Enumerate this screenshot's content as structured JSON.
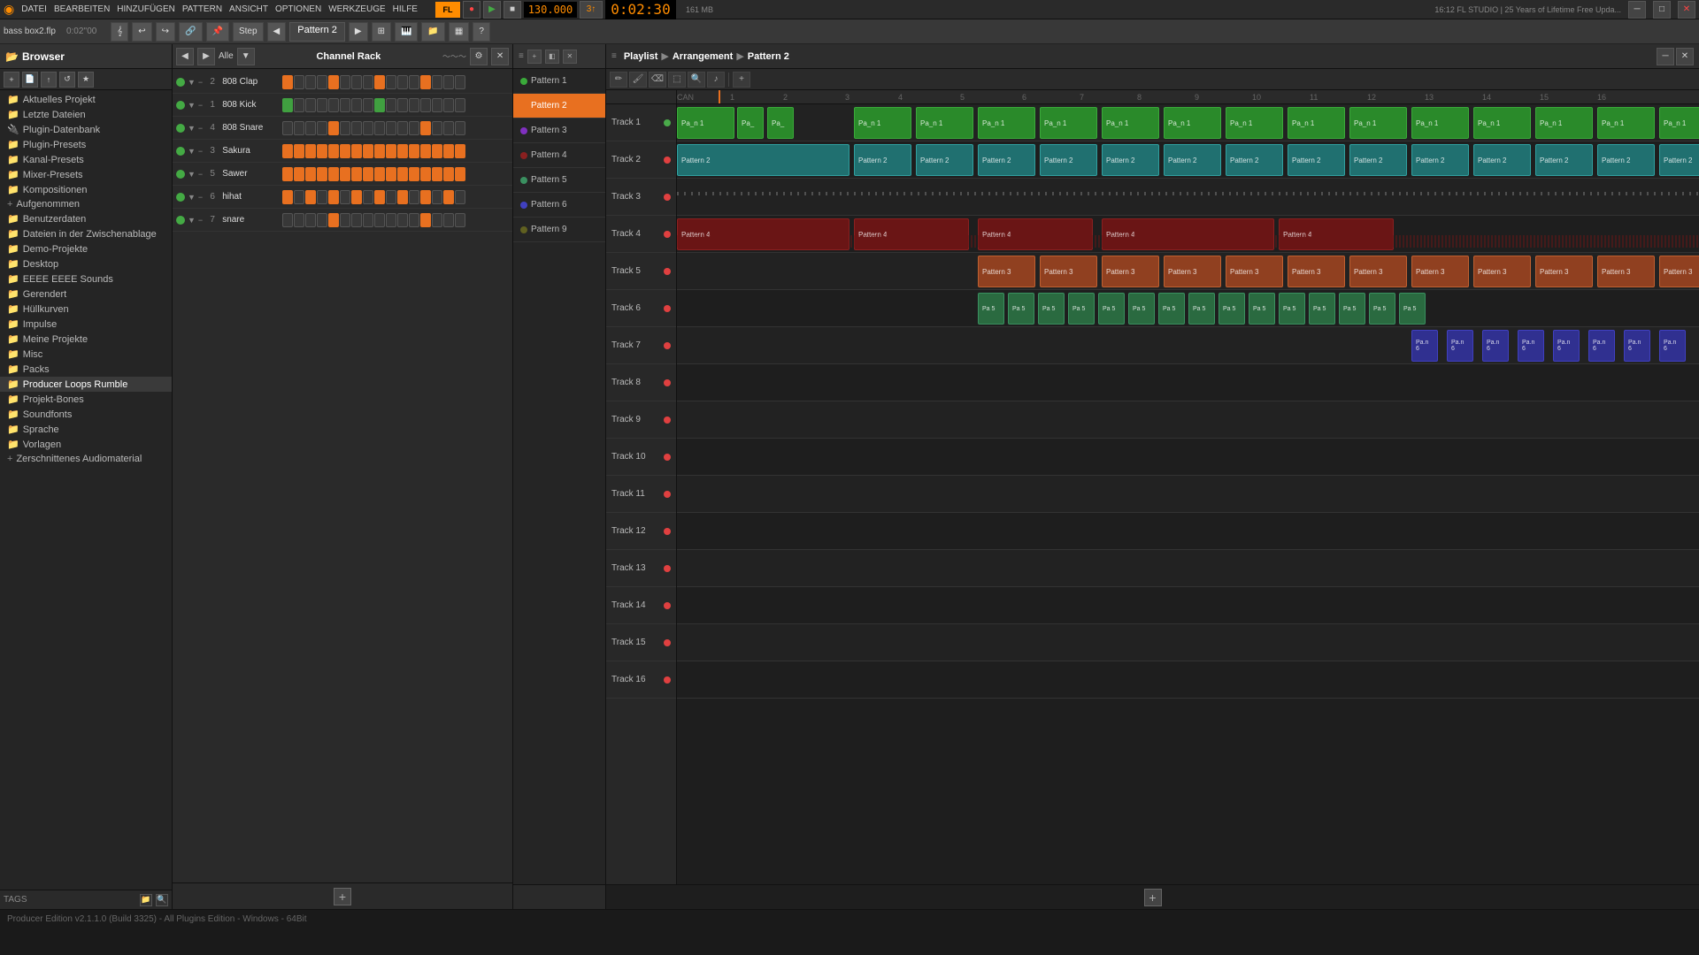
{
  "top_menu": {
    "items": [
      "DATEI",
      "BEARBEITEN",
      "HINZUFÜGEN",
      "PATTERN",
      "ANSICHT",
      "OPTIONEN",
      "WERKZEUGE",
      "HILFE"
    ]
  },
  "transport": {
    "bpm": "130.000",
    "time": "0:02:30",
    "beats": "3",
    "record_label": "●",
    "play_label": "▶",
    "stop_label": "■",
    "cpu_label": "161 MB",
    "fl_version": "16:12  FL STUDIO | 25\nYears of Lifetime Free Upda..."
  },
  "toolbar2": {
    "step_label": "Step",
    "pattern_label": "Pattern 2",
    "file_label": "bass box2.flp",
    "time_label": "0:02''00"
  },
  "browser": {
    "title": "Browser",
    "items": [
      {
        "label": "Aktuelles Projekt",
        "icon": "folder",
        "type": "folder"
      },
      {
        "label": "Letzte Dateien",
        "icon": "folder",
        "type": "folder"
      },
      {
        "label": "Plugin-Datenbank",
        "icon": "folder",
        "type": "folder"
      },
      {
        "label": "Plugin-Presets",
        "icon": "folder",
        "type": "folder"
      },
      {
        "label": "Kanal-Presets",
        "icon": "folder",
        "type": "folder"
      },
      {
        "label": "Mixer-Presets",
        "icon": "folder",
        "type": "folder"
      },
      {
        "label": "Kompositionen",
        "icon": "folder",
        "type": "folder"
      },
      {
        "label": "Aufgenommen",
        "icon": "add",
        "type": "add-folder"
      },
      {
        "label": "Benutzerdaten",
        "icon": "folder",
        "type": "folder"
      },
      {
        "label": "Dateien in der Zwischenablage",
        "icon": "folder",
        "type": "folder"
      },
      {
        "label": "Demo-Projekte",
        "icon": "folder",
        "type": "folder"
      },
      {
        "label": "Desktop",
        "icon": "folder",
        "type": "folder"
      },
      {
        "label": "EEEE EEEE Sounds",
        "icon": "folder",
        "type": "folder"
      },
      {
        "label": "Gerendert",
        "icon": "folder",
        "type": "folder"
      },
      {
        "label": "Hüllkurven",
        "icon": "folder",
        "type": "folder"
      },
      {
        "label": "Impulse",
        "icon": "folder",
        "type": "folder"
      },
      {
        "label": "Meine Projekte",
        "icon": "folder",
        "type": "folder"
      },
      {
        "label": "Misc",
        "icon": "folder",
        "type": "folder"
      },
      {
        "label": "Packs",
        "icon": "folder",
        "type": "folder"
      },
      {
        "label": "Producer Loops Rumble",
        "icon": "folder",
        "type": "folder"
      },
      {
        "label": "Projekt-Bones",
        "icon": "folder",
        "type": "folder"
      },
      {
        "label": "Soundfonts",
        "icon": "folder",
        "type": "folder"
      },
      {
        "label": "Sprache",
        "icon": "folder",
        "type": "folder"
      },
      {
        "label": "Vorlagen",
        "icon": "folder",
        "type": "folder"
      },
      {
        "label": "Zerschnittenes Audiomaterial",
        "icon": "add",
        "type": "add-folder"
      }
    ],
    "tags_label": "TAGS"
  },
  "channel_rack": {
    "title": "Channel Rack",
    "filter_label": "Alle",
    "channels": [
      {
        "num": "2",
        "name": "808 Clap",
        "color": "#e87020"
      },
      {
        "num": "1",
        "name": "808 Kick",
        "color": "#4a8a4a"
      },
      {
        "num": "4",
        "name": "808 Snare",
        "color": "#e87020"
      },
      {
        "num": "3",
        "name": "Sakura",
        "color": "#e87020"
      },
      {
        "num": "5",
        "name": "Sawer",
        "color": "#e87020"
      },
      {
        "num": "6",
        "name": "hihat",
        "color": "#e87020"
      },
      {
        "num": "7",
        "name": "snare",
        "color": "#e87020"
      }
    ]
  },
  "patterns": {
    "title": "Patterns",
    "items": [
      {
        "label": "Pattern 1",
        "color": "#3aaa3a"
      },
      {
        "label": "Pattern 2",
        "color": "#e87020",
        "selected": true
      },
      {
        "label": "Pattern 3",
        "color": "#8030c0"
      },
      {
        "label": "Pattern 4",
        "color": "#8a2020"
      },
      {
        "label": "Pattern 5",
        "color": "#3a9060"
      },
      {
        "label": "Pattern 6",
        "color": "#4040c0"
      },
      {
        "label": "Pattern 9",
        "color": "#606020"
      }
    ]
  },
  "playlist": {
    "title": "Playlist",
    "subtitle": "Arrangement",
    "pattern": "Pattern 2",
    "tracks": [
      {
        "label": "Track 1",
        "color": "#2a8a2a",
        "dot_color": "#4aaa4a"
      },
      {
        "label": "Track 2",
        "color": "#207070",
        "dot_color": "#30a0a0"
      },
      {
        "label": "Track 3",
        "color": "#602090",
        "dot_color": "#8030c0"
      },
      {
        "label": "Track 4",
        "color": "#8a2020",
        "dot_color": "#c03030"
      },
      {
        "label": "Track 5",
        "color": "#904020",
        "dot_color": "#c06030"
      },
      {
        "label": "Track 6",
        "color": "#2a6a40",
        "dot_color": "#3a9060"
      },
      {
        "label": "Track 7",
        "color": "#303090",
        "dot_color": "#4040c0"
      },
      {
        "label": "Track 8",
        "color": "#444",
        "dot_color": "#e04040"
      },
      {
        "label": "Track 9",
        "color": "#444",
        "dot_color": "#e04040"
      },
      {
        "label": "Track 10",
        "color": "#444",
        "dot_color": "#e04040"
      },
      {
        "label": "Track 11",
        "color": "#444",
        "dot_color": "#e04040"
      },
      {
        "label": "Track 12",
        "color": "#444",
        "dot_color": "#e04040"
      },
      {
        "label": "Track 13",
        "color": "#444",
        "dot_color": "#e04040"
      },
      {
        "label": "Track 14",
        "color": "#444",
        "dot_color": "#e04040"
      },
      {
        "label": "Track 15",
        "color": "#444",
        "dot_color": "#e04040"
      },
      {
        "label": "Track 16",
        "color": "#444",
        "dot_color": "#e04040"
      }
    ]
  },
  "status_bar": {
    "text": "Producer Edition v2.1.1.0 (Build 3325) - All Plugins Edition - Windows - 64Bit"
  }
}
